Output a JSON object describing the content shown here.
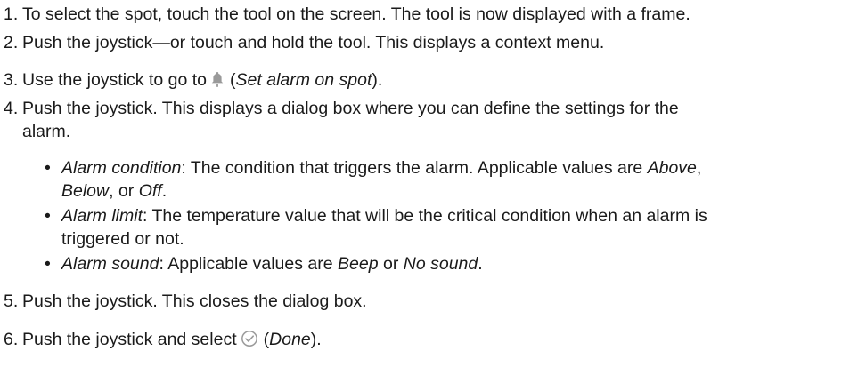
{
  "steps": [
    {
      "num": "1.",
      "text": "To select the spot, touch the tool on the screen. The tool is now displayed with a frame."
    },
    {
      "num": "2.",
      "text": "Push the joystick—or touch and hold the tool. This displays a context menu."
    },
    {
      "num": "3.",
      "prefix": "Use the joystick to go to",
      "paren_open": "(",
      "label": "Set alarm on spot",
      "paren_close": ").",
      "icon": "bell-icon"
    },
    {
      "num": "4.",
      "line1": "Push the joystick. This displays a dialog box where you can define the settings for the",
      "line2": "alarm."
    },
    {
      "num": "5.",
      "text": "Push the joystick. This closes the dialog box."
    },
    {
      "num": "6.",
      "prefix": "Push the joystick and select",
      "paren_open": "(",
      "label": "Done",
      "paren_close": ").",
      "icon": "check-circle-icon"
    }
  ],
  "bullets": [
    {
      "term": "Alarm condition",
      "line1_text": ": The condition that triggers the alarm. Applicable values are ",
      "v1": "Above",
      "sep1": ",",
      "v2": "Below",
      "sep2": ", or ",
      "v3": "Off",
      "end": "."
    },
    {
      "term": "Alarm limit",
      "line1_text": ": The temperature value that will be the critical condition when an alarm is",
      "line2_text": "triggered or not."
    },
    {
      "term": "Alarm sound",
      "mid": ": Applicable values are ",
      "v1": "Beep",
      "sep": " or ",
      "v2": "No sound",
      "end": "."
    }
  ],
  "bullet_glyph": "•",
  "colors": {
    "text": "#1a1a1a",
    "icon": "#9a9a9a"
  }
}
